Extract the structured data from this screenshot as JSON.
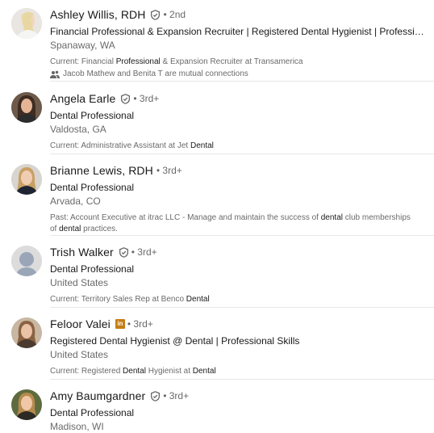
{
  "results": [
    {
      "name": "Ashley Willis, RDH",
      "badge": "verified-icon",
      "degree": "• 2nd",
      "headline": "Financial Professional & Expansion Recruiter | Registered Dental Hygienist | Professional...",
      "location": "Spanaway, WA",
      "summary_prefix": "Current: Financial ",
      "summary_bold": "Professional",
      "summary_suffix": " & Expansion Recruiter at Transamerica",
      "mutual": "Jacob Mathew and Benita T are mutual connections"
    },
    {
      "name": "Angela Earle",
      "badge": "verified-icon",
      "degree": "• 3rd+",
      "headline": "Dental Professional",
      "location": "Valdosta, GA",
      "summary_prefix": "Current: Administrative Assistant at Jet ",
      "summary_bold": "Dental",
      "summary_suffix": ""
    },
    {
      "name": "Brianne Lewis, RDH",
      "degree": "• 3rd+",
      "headline": "Dental Professional",
      "location": "Arvada, CO",
      "summary_line1_prefix": "Past: Account Executive at itrac LLC - Manage and maintain the success of ",
      "summary_line1_bold": "dental",
      "summary_line1_suffix": " club memberships",
      "summary_line2_prefix": "of ",
      "summary_line2_bold": "dental",
      "summary_line2_suffix": " practices."
    },
    {
      "name": "Trish Walker",
      "badge": "verified-icon",
      "degree": "• 3rd+",
      "headline": "Dental Professional",
      "location": "United States",
      "summary_prefix": "Current: Territory Sales Rep at Benco ",
      "summary_bold": "Dental",
      "summary_suffix": ""
    },
    {
      "name": "Feloor Valei",
      "badge": "linkedin-premium-icon",
      "badge_text": "in",
      "degree": "• 3rd+",
      "headline": "Registered Dental Hygienist @ Dental | Professional Skills",
      "location": "United States",
      "summary_prefix": "Current: Registered ",
      "summary_bold": "Dental",
      "summary_middle": " Hygienist at ",
      "summary_bold2": "Dental",
      "summary_suffix": ""
    },
    {
      "name": "Amy Baumgardner",
      "badge": "verified-icon",
      "degree": "• 3rd+",
      "headline": "Dental Professional",
      "location": "Madison, WI"
    }
  ],
  "colors": {
    "primary_text": "#000000e6",
    "secondary_text": "#00000099",
    "divider": "#e8e8e8",
    "premium_badge": "#c37d16",
    "avatar_placeholder": "#d9d9d9"
  }
}
